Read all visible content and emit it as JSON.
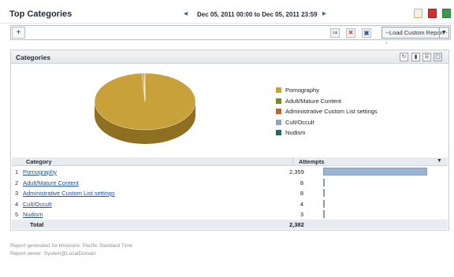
{
  "header": {
    "title": "Top Categories",
    "date_range": "Dec 05, 2011 00:00 to Dec 05, 2011 23:59",
    "prev_icon": "chevron-left-icon",
    "next_icon": "chevron-right-icon",
    "tools": [
      "calendar-icon",
      "pdf-export-icon",
      "excel-export-icon"
    ]
  },
  "filter_bar": {
    "add_label": "+",
    "filter_value": "",
    "go_icon": "arrow-right-icon",
    "clear_icon": "close-icon",
    "save_icon": "floppy-disk-icon",
    "custom_report_label": "--Load Custom Report --",
    "dropdown_icon": "chevron-down-icon"
  },
  "panel": {
    "title": "Categories",
    "tools": [
      "refresh-icon",
      "bar-chart-icon",
      "table-view-icon",
      "maximize-icon"
    ]
  },
  "legend": [
    {
      "label": "Pornography",
      "color": "#c9a13a"
    },
    {
      "label": "Adult/Mature Content",
      "color": "#7c8a24"
    },
    {
      "label": "Administrative Custom List settings",
      "color": "#b8642e"
    },
    {
      "label": "Cult/Occult",
      "color": "#8fa6bd"
    },
    {
      "label": "Nudism",
      "color": "#1f6b62"
    }
  ],
  "table": {
    "headers": {
      "category": "Category",
      "attempts": "Attempts"
    },
    "sort_icon": "sort-down-icon",
    "rows": [
      {
        "num": "1",
        "category": "Pornography",
        "attempts": "2,359"
      },
      {
        "num": "2",
        "category": "Adult/Mature Content",
        "attempts": "8"
      },
      {
        "num": "3",
        "category": "Administrative Custom List settings",
        "attempts": "8"
      },
      {
        "num": "4",
        "category": "Cult/Occult",
        "attempts": "4"
      },
      {
        "num": "5",
        "category": "Nudism",
        "attempts": "3"
      }
    ],
    "total_label": "Total",
    "total_value": "2,382"
  },
  "footer": {
    "timezone": "Report generated for timezone: Pacific Standard Time",
    "owner": "Report owner: System@LocalDomain"
  },
  "chart_data": {
    "type": "pie",
    "title": "",
    "categories": [
      "Pornography",
      "Adult/Mature Content",
      "Administrative Custom List settings",
      "Cult/Occult",
      "Nudism"
    ],
    "values": [
      2359,
      8,
      8,
      4,
      3
    ],
    "colors": [
      "#c9a13a",
      "#7c8a24",
      "#b8642e",
      "#8fa6bd",
      "#1f6b62"
    ],
    "legend_position": "right"
  }
}
